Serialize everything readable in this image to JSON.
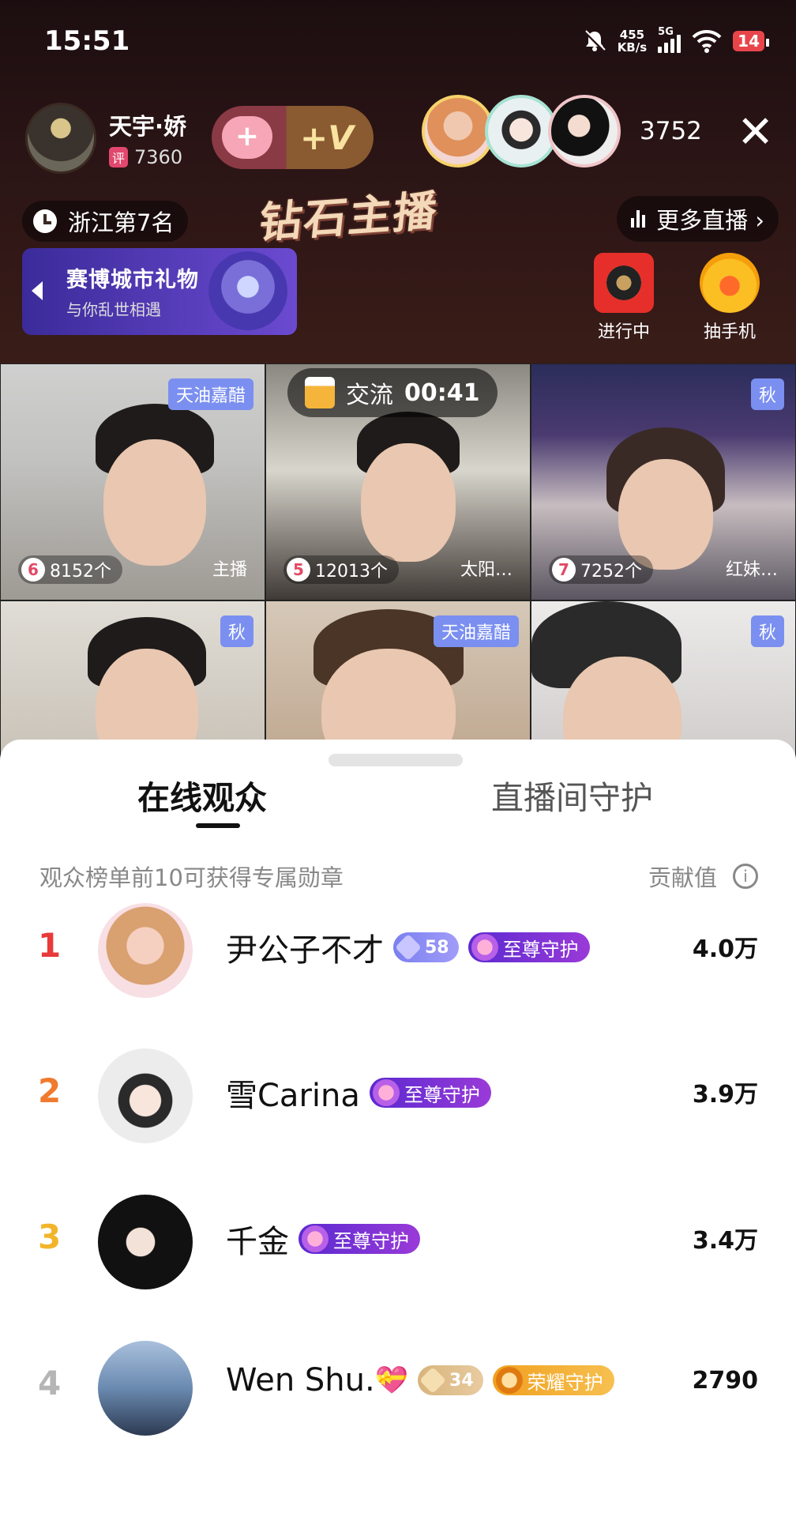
{
  "status_bar": {
    "time": "15:51",
    "net_speed_value": "455",
    "net_speed_unit": "KB/s",
    "network": "5G",
    "battery": "14"
  },
  "host": {
    "name": "天宇·娇",
    "score_badge": "评",
    "score": "7360"
  },
  "follow": {
    "plus": "+",
    "v_label": "+V"
  },
  "viewers": {
    "count": "3752"
  },
  "close_label": "✕",
  "rank": {
    "text": "浙江第7名"
  },
  "diamond_title": "钻石主播",
  "more_live": "更多直播 ›",
  "gift_banner": {
    "title": "赛博城市礼物",
    "subtitle": "与你乱世相遇"
  },
  "actions": [
    {
      "label": "进行中"
    },
    {
      "label": "抽手机"
    }
  ],
  "timer": {
    "label": "交流",
    "time": "00:41"
  },
  "tiles": [
    {
      "tag": "天油嘉醋",
      "rank": "6",
      "gifts": "8152个",
      "role": "主播"
    },
    {
      "tag": "",
      "rank": "5",
      "gifts": "12013个",
      "role": "太阳…"
    },
    {
      "tag": "秋",
      "rank": "7",
      "gifts": "7252个",
      "role": "红妹…"
    },
    {
      "tag": "秋"
    },
    {
      "tag": "天油嘉醋"
    },
    {
      "tag": "秋"
    }
  ],
  "tabs": [
    {
      "label": "在线观众"
    },
    {
      "label": "直播间守护"
    }
  ],
  "hint": "观众榜单前10可获得专属勋章",
  "contribution_label": "贡献值",
  "info_icon": "i",
  "audience": [
    {
      "rank": "1",
      "name": "尹公子不才",
      "level": "58",
      "guard": "至尊守护",
      "value": "4.0万"
    },
    {
      "rank": "2",
      "name": "雪Carina",
      "guard": "至尊守护",
      "value": "3.9万"
    },
    {
      "rank": "3",
      "name": "千金",
      "guard": "至尊守护",
      "value": "3.4万"
    },
    {
      "rank": "4",
      "name": "Wen Shu.",
      "emoji": "💝",
      "level": "34",
      "guard": "荣耀守护",
      "value": "2790"
    }
  ],
  "colors": {
    "rank1": "#e83a3a",
    "rank2": "#f07a2e",
    "rank3": "#f2b52a",
    "rank4": "#b5b5b5",
    "accent_purple": "#7a8ff0"
  }
}
